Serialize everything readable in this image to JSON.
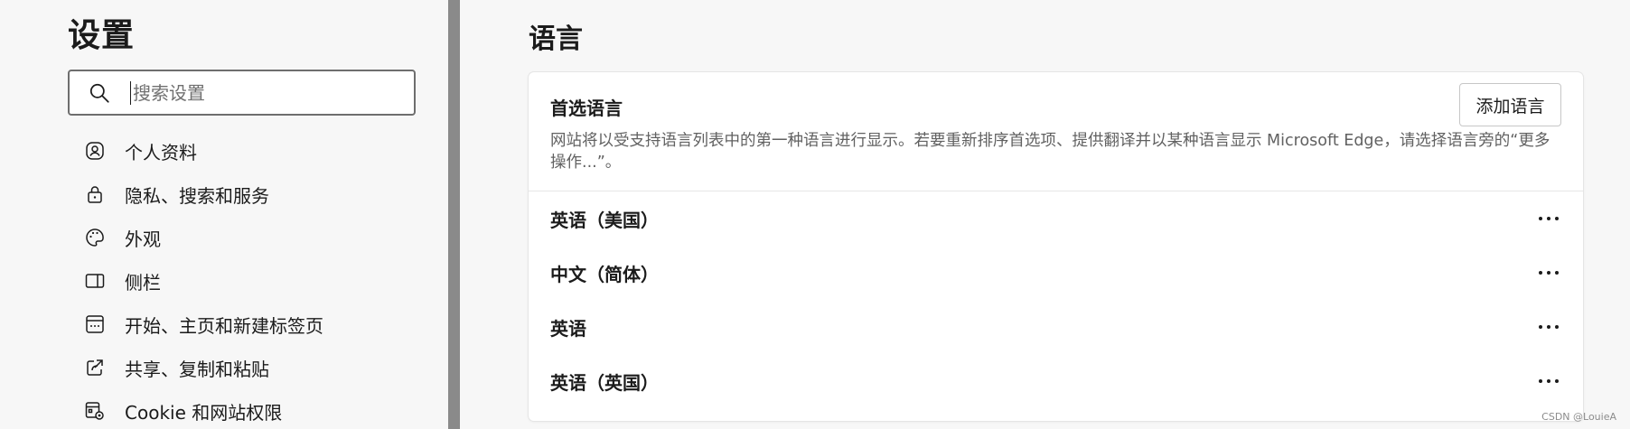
{
  "sidebar": {
    "title": "设置",
    "search": {
      "placeholder": "搜索设置",
      "value": ""
    },
    "items": [
      {
        "label": "个人资料",
        "icon": "profile-icon"
      },
      {
        "label": "隐私、搜索和服务",
        "icon": "lock-icon"
      },
      {
        "label": "外观",
        "icon": "palette-icon"
      },
      {
        "label": "侧栏",
        "icon": "sidebar-icon"
      },
      {
        "label": "开始、主页和新建标签页",
        "icon": "home-tabs-icon"
      },
      {
        "label": "共享、复制和粘贴",
        "icon": "share-icon"
      },
      {
        "label": "Cookie 和网站权限",
        "icon": "site-permissions-icon"
      }
    ]
  },
  "main": {
    "title": "语言",
    "preferred": {
      "heading": "首选语言",
      "description": "网站将以受支持语言列表中的第一种语言进行显示。若要重新排序首选项、提供翻译并以某种语言显示 Microsoft Edge，请选择语言旁的“更多操作...”。",
      "add_button": "添加语言"
    },
    "languages": [
      {
        "name": "英语（美国）"
      },
      {
        "name": "中文（简体）"
      },
      {
        "name": "英语"
      },
      {
        "name": "英语（英国）"
      }
    ]
  },
  "watermark": "CSDN @LouieA"
}
